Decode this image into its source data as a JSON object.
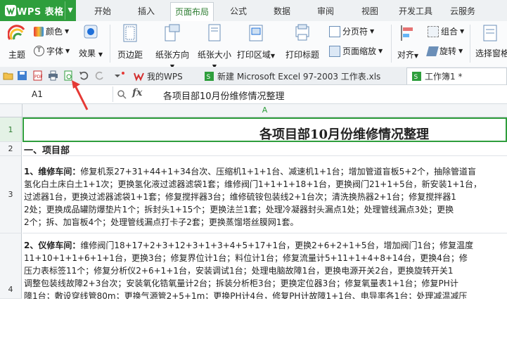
{
  "app": {
    "name": "WPS 表格"
  },
  "ribbon_tabs": [
    "开始",
    "插入",
    "页面布局",
    "公式",
    "数据",
    "审阅",
    "视图",
    "开发工具",
    "云服务"
  ],
  "active_tab": "页面布局",
  "ribbon": {
    "theme": "主题",
    "color": "颜色",
    "font": "字体",
    "effect": "效果",
    "margin": "页边距",
    "orientation": "纸张方向",
    "paper_size": "纸张大小",
    "print_area": "打印区域",
    "print_title": "打印标题",
    "page_break": "分页符",
    "page_zoom": "页面缩放",
    "align": "对齐",
    "group": "组合",
    "rotate": "旋转",
    "select_pane": "选择窗格"
  },
  "doc_tabs": [
    {
      "label": "我的WPS"
    },
    {
      "label": "新建 Microsoft Excel 97-2003 工作表.xls"
    },
    {
      "label": "工作簿1 *"
    }
  ],
  "formula_bar": {
    "cell_ref": "A1",
    "fx": "fx",
    "content": "各项目部10月份维修情况整理"
  },
  "column_header": "A",
  "rows": [
    {
      "num": "1",
      "text": "各项目部10月份维修情况整理"
    },
    {
      "num": "2",
      "text": "一、项目部"
    },
    {
      "num": "3",
      "lead": "1、维修车间：",
      "lines": [
        "修复机泵27+31+44+1+34台次、压缩机1+1+1台、减速机1+1台；增加管道盲板5+2个，抽除管道盲",
        "氢化白土床白土1+1次；更换氢化液过滤器滤袋1套；维修阀门1+1+1+18+1台，更换阀门21+1+5台，新安装1+1台，",
        "过滤器1台，更换过滤器滤袋1+1套；修复搅拌器3台；维修硫铵包装线2+1台次；清洗换热器2+1台；修复搅拌器1",
        "2处；更换成品罐防爆垫片1个；拆封头1+15个；更换法兰1套；处理冷凝器封头漏点1处；处理管线漏点3处；更换",
        "2个；拆、加盲板4个；处理管线漏点打卡子2套；更换蒸馏塔丝膜网1套。"
      ]
    },
    {
      "num": "4",
      "lead": "2、仪修车间：",
      "lines": [
        "维修阀门18+17+2+3+12+3+1+3+4+5+17+1台，更换2+6+2+1+5台，增加阀门1台；修复温度",
        "11+10+1+1+6+1+1台，更换3台；修复界位计1台；料位计1台；修复流量计5+11+1+4+8+14台，更换4台；修",
        "压力表标签11个；修复分析仪2+6+1+1台，安装调试1台；处理电脑故障1台，更换电源开关2台，更换旋转开关1",
        "调整包装线故障2+3台次；安装氧化锆氧量计2台；拆装分析柜3台；更换定位器3台；修复氧量表1+1台；修复PH计",
        "障1台；敷设穿线管80m；更换气源管2+5+1m；更换PH计4台，修复PH计故障1+1台、电导率各1台；处理减温减压"
      ]
    }
  ]
}
